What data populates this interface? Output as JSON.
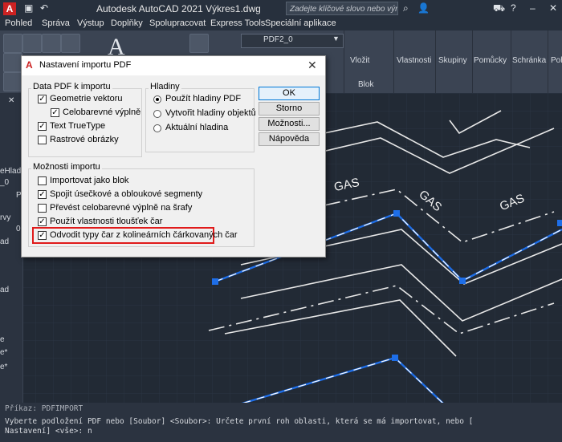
{
  "window": {
    "title": "Autodesk AutoCAD 2021   Výkres1.dwg",
    "search_placeholder": "Zadejte klíčové slovo nebo výraz",
    "icons": [
      "logo-icon",
      "save-icon",
      "undo-icon",
      "search-icon",
      "user-icon",
      "cart-icon",
      "help-icon",
      "minimize-icon",
      "maximize-icon",
      "close-icon"
    ]
  },
  "menu": [
    "Pohled",
    "Správa",
    "Výstup",
    "Doplňky",
    "Spolupracovat",
    "Express Tools",
    "Speciální aplikace"
  ],
  "ribbon": {
    "layer_name": "PDF2_0",
    "panels": [
      "Vložit",
      "Vlastnosti",
      "Skupiny",
      "Pomůcky",
      "Schránka",
      "Poh"
    ],
    "block_label": "Blok"
  },
  "left_panel": [
    "eHlad",
    "_0",
    "P",
    "rvy",
    "0",
    "ad",
    "ad",
    "e",
    "e*",
    "e*"
  ],
  "dialog": {
    "title": "Nastavení importu PDF",
    "group_data": "Data PDF k importu",
    "data_options": [
      {
        "label": "Geometrie vektoru",
        "checked": true
      },
      {
        "label": "Celobarevné výplně",
        "checked": true
      },
      {
        "label": "Text TrueType",
        "checked": true
      },
      {
        "label": "Rastrové obrázky",
        "checked": false
      }
    ],
    "group_layers": "Hladiny",
    "layer_options": [
      {
        "label": "Použít hladiny PDF",
        "selected": true
      },
      {
        "label": "Vytvořit hladiny objektů",
        "selected": false
      },
      {
        "label": "Aktuální hladina",
        "selected": false
      }
    ],
    "group_import": "Možnosti importu",
    "import_options": [
      {
        "label": "Importovat jako blok",
        "checked": false
      },
      {
        "label": "Spojit úsečkové a obloukové segmenty",
        "checked": true
      },
      {
        "label": "Převést celobarevné výplně na šrafy",
        "checked": false
      },
      {
        "label": "Použít vlastnosti tloušťek čar",
        "checked": true
      },
      {
        "label": "Odvodit typy čar z kolineárních čárkovaných čar",
        "checked": true
      }
    ],
    "buttons": [
      "OK",
      "Storno",
      "Možnosti...",
      "Nápověda"
    ]
  },
  "drawing": {
    "gas_labels": [
      "GAS",
      "GAS",
      "GAS"
    ]
  },
  "command": {
    "history": "Příkaz: PDFIMPORT",
    "line1": "Vyberte podložení PDF nebo [Soubor] <Soubor>: Určete první roh oblasti, která se má importovat, nebo [",
    "line2": "Nastavení] <vše>: n"
  },
  "colors": {
    "accent_blue": "#1e6ee8",
    "highlight_red": "#e01b1b"
  }
}
